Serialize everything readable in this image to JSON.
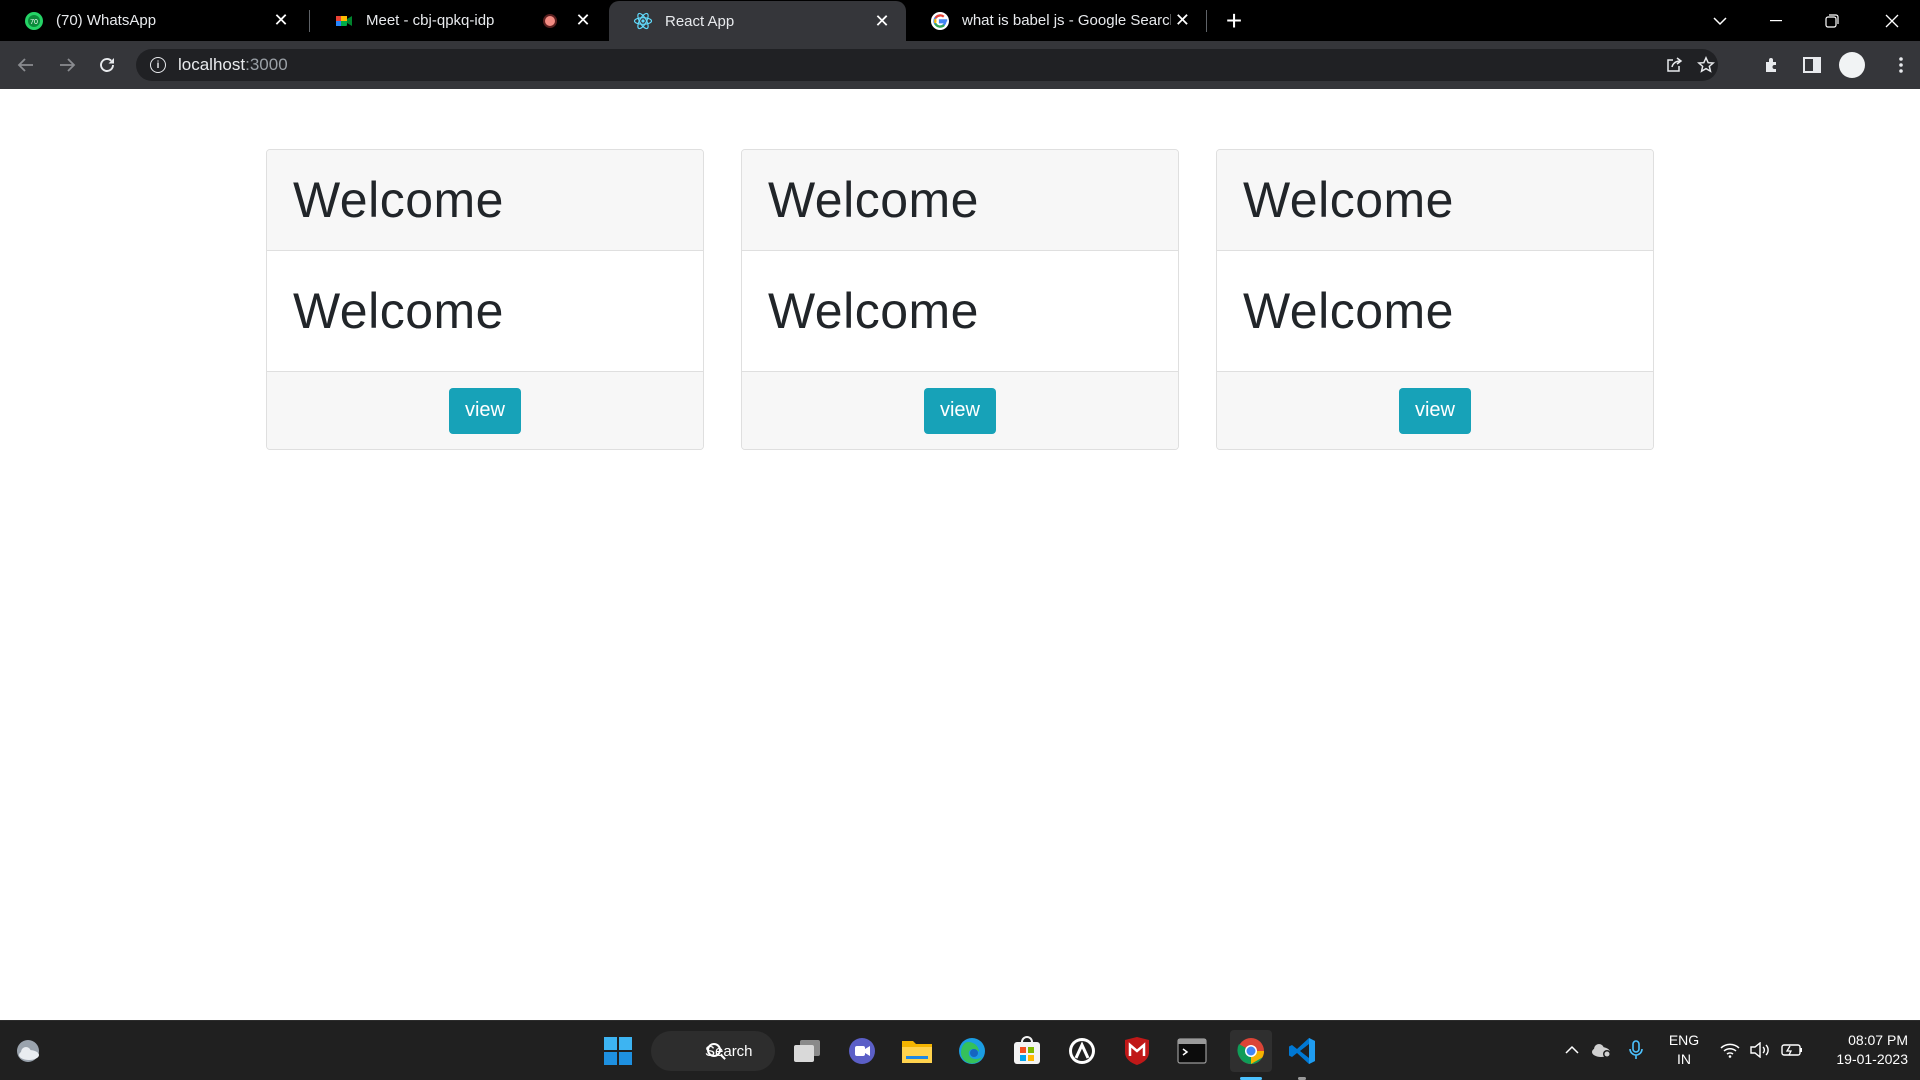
{
  "browser": {
    "tabs": [
      {
        "title": "(70) WhatsApp",
        "badge": "70"
      },
      {
        "title": "Meet - cbj-qpkq-idp"
      },
      {
        "title": "React App"
      },
      {
        "title": "what is babel js - Google Search"
      }
    ],
    "active_tab": "React App",
    "url_host": "localhost",
    "url_port": ":3000"
  },
  "page": {
    "cards": [
      {
        "header": "Welcome",
        "body": "Welcome",
        "button": "view"
      },
      {
        "header": "Welcome",
        "body": "Welcome",
        "button": "view"
      },
      {
        "header": "Welcome",
        "body": "Welcome",
        "button": "view"
      }
    ],
    "button_color": "#17a2b8"
  },
  "taskbar": {
    "search_label": "Search",
    "language": "ENG",
    "region": "IN",
    "time": "08:07 PM",
    "date": "19-01-2023",
    "apps": [
      "start-icon",
      "task-view-icon",
      "teams-icon",
      "file-explorer-icon",
      "edge-icon",
      "store-icon",
      "app-icon",
      "mcafee-icon",
      "terminal-icon",
      "chrome-icon",
      "vscode-icon"
    ]
  }
}
